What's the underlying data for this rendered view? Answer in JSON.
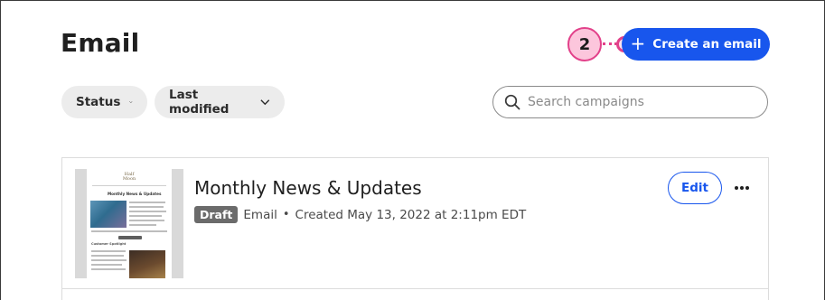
{
  "header": {
    "title": "Email",
    "create_label": "Create an email",
    "create_icon": "plus-icon",
    "step_number": "2"
  },
  "filters": {
    "status_label": "Status",
    "modified_label": "Last modified",
    "chevron_icon": "chevron-down-icon"
  },
  "search": {
    "placeholder": "Search campaigns",
    "value": "",
    "icon": "search-icon"
  },
  "campaigns": [
    {
      "title": "Monthly News & Updates",
      "status": "Draft",
      "type": "Email",
      "created": "Created May 13, 2022 at 2:11pm EDT",
      "edit_label": "Edit",
      "more_icon": "more-horizontal-icon",
      "thumbnail": {
        "logo_text": "Half Moon",
        "heading": "Monthly News & Updates",
        "subheading": "Customer Spotlight"
      }
    }
  ],
  "colors": {
    "primary": "#1856ed",
    "draft_badge": "#6b6b6b",
    "step_accent": "#e2418a",
    "step_fill": "#fcc6dc"
  }
}
